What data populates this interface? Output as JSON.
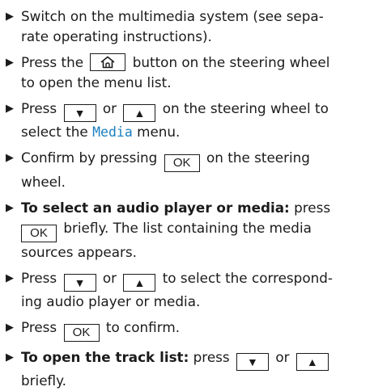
{
  "keys": {
    "ok": "OK",
    "down": "▼",
    "up": "▲",
    "home_icon": "home-icon"
  },
  "steps": {
    "s1": {
      "l1": "Switch on the multimedia system (see sepa-",
      "l2": "rate operating instructions)."
    },
    "s2": {
      "a": "Press the",
      "b": "button on the steering wheel",
      "l2": "to open the menu list."
    },
    "s3": {
      "a": "Press",
      "b": "or",
      "c": "on the steering wheel to",
      "d": "select the",
      "media": "Media",
      "e": "menu."
    },
    "s4": {
      "a": "Confirm by pressing",
      "b": "on the steering",
      "l2": "wheel."
    },
    "s5": {
      "bold": "To select an audio player or media:",
      "a": "press",
      "b": "briefly. The list containing the media",
      "l3": "sources appears."
    },
    "s6": {
      "a": "Press",
      "b": "or",
      "c": "to select the correspond-",
      "l2": "ing audio player or media."
    },
    "s7": {
      "a": "Press",
      "b": "to confirm."
    },
    "s8": {
      "bold": "To open the track list:",
      "a": "press",
      "b": "or",
      "l2": "briefly."
    }
  }
}
